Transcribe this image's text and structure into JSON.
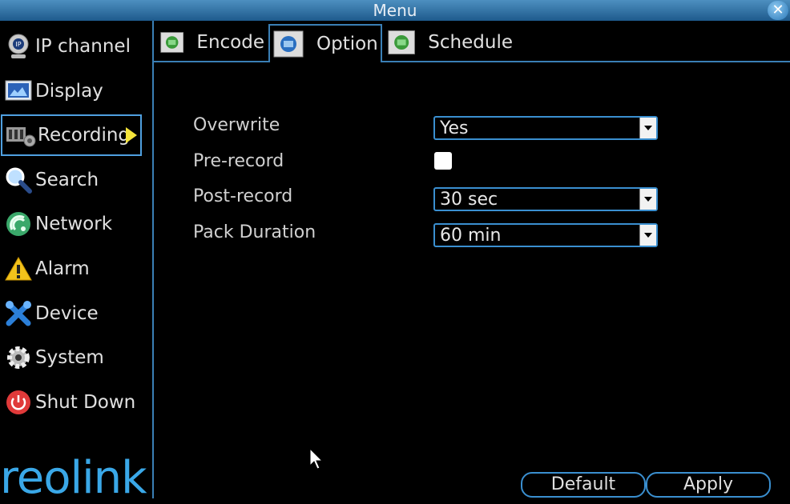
{
  "window": {
    "title": "Menu",
    "close_icon": "close-icon"
  },
  "sidebar": {
    "items": [
      {
        "label": "IP channel",
        "icon": "ip-camera-icon"
      },
      {
        "label": "Display",
        "icon": "display-icon"
      },
      {
        "label": "Recording",
        "icon": "recording-icon",
        "active": true
      },
      {
        "label": "Search",
        "icon": "search-icon"
      },
      {
        "label": "Network",
        "icon": "network-icon"
      },
      {
        "label": "Alarm",
        "icon": "alarm-icon"
      },
      {
        "label": "Device",
        "icon": "device-icon"
      },
      {
        "label": "System",
        "icon": "gear-icon"
      },
      {
        "label": "Shut Down",
        "icon": "power-icon"
      }
    ],
    "logo": "reolink"
  },
  "tabs": [
    {
      "label": "Encode",
      "icon": "encode-icon"
    },
    {
      "label": "Option",
      "icon": "option-icon",
      "active": true
    },
    {
      "label": "Schedule",
      "icon": "schedule-icon"
    }
  ],
  "form": {
    "overwrite": {
      "label": "Overwrite",
      "value": "Yes"
    },
    "prerecord": {
      "label": "Pre-record",
      "checked": false
    },
    "postrecord": {
      "label": "Post-record",
      "value": "30 sec"
    },
    "pack_duration": {
      "label": "Pack Duration",
      "value": "60 min"
    }
  },
  "buttons": {
    "default": "Default",
    "apply": "Apply"
  },
  "colors": {
    "accent": "#3a8fd0",
    "arrow": "#f4e43a",
    "logo": "#3aa8e8",
    "titlebar": "#2f6fa3"
  }
}
